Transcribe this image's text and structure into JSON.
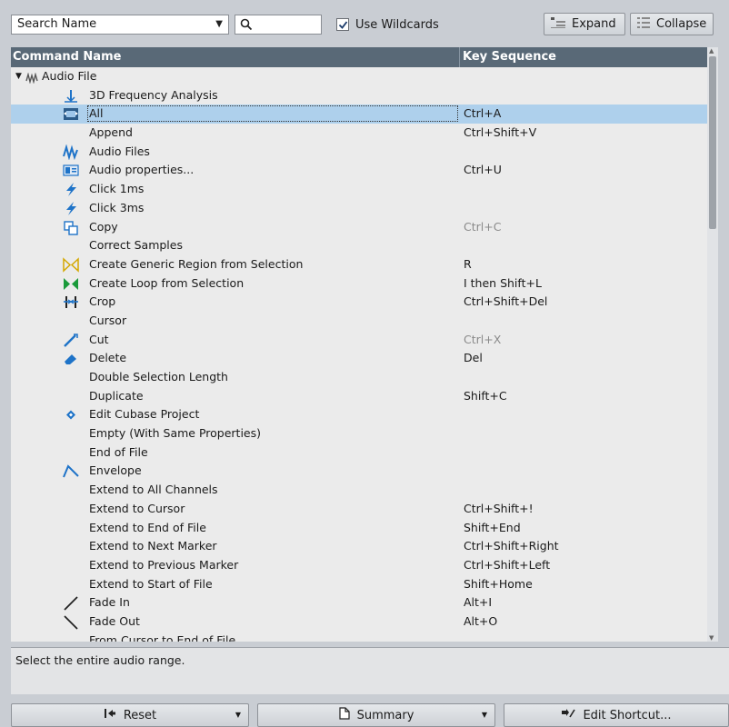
{
  "toolbar": {
    "search_mode": "Search Name",
    "search_value": "",
    "wildcards_label": "Use Wildcards",
    "wildcards_checked": true,
    "expand_label": "Expand",
    "collapse_label": "Collapse"
  },
  "table": {
    "columns": [
      "Command Name",
      "Key Sequence"
    ],
    "root": {
      "label": "Audio File",
      "expanded": true
    },
    "rows": [
      {
        "name": "3D Frequency Analysis",
        "key": "",
        "icon": "3d-analysis-icon"
      },
      {
        "name": "All",
        "key": "Ctrl+A",
        "icon": "select-all-icon",
        "selected": true
      },
      {
        "name": "Append",
        "key": "Ctrl+Shift+V",
        "icon": ""
      },
      {
        "name": "Audio Files",
        "key": "",
        "icon": "waveform-icon"
      },
      {
        "name": "Audio properties...",
        "key": "Ctrl+U",
        "icon": "audio-properties-icon"
      },
      {
        "name": "Click 1ms",
        "key": "",
        "icon": "lightning-icon"
      },
      {
        "name": "Click 3ms",
        "key": "",
        "icon": "lightning-icon"
      },
      {
        "name": "Copy",
        "key": "Ctrl+C",
        "icon": "copy-icon",
        "dim": true
      },
      {
        "name": "Correct Samples",
        "key": "",
        "icon": ""
      },
      {
        "name": "Create Generic Region from Selection",
        "key": "R",
        "icon": "region-icon"
      },
      {
        "name": "Create Loop from Selection",
        "key": "I then Shift+L",
        "icon": "loop-icon"
      },
      {
        "name": "Crop",
        "key": "Ctrl+Shift+Del",
        "icon": "crop-icon"
      },
      {
        "name": "Cursor",
        "key": "",
        "icon": ""
      },
      {
        "name": "Cut",
        "key": "Ctrl+X",
        "icon": "cut-icon",
        "dim": true
      },
      {
        "name": "Delete",
        "key": "Del",
        "icon": "eraser-icon"
      },
      {
        "name": "Double Selection Length",
        "key": "",
        "icon": ""
      },
      {
        "name": "Duplicate",
        "key": "Shift+C",
        "icon": ""
      },
      {
        "name": "Edit Cubase Project",
        "key": "",
        "icon": "cubase-icon"
      },
      {
        "name": "Empty (With Same Properties)",
        "key": "",
        "icon": ""
      },
      {
        "name": "End of File",
        "key": "",
        "icon": ""
      },
      {
        "name": "Envelope",
        "key": "",
        "icon": "envelope-icon"
      },
      {
        "name": "Extend to All Channels",
        "key": "",
        "icon": ""
      },
      {
        "name": "Extend to Cursor",
        "key": "Ctrl+Shift+!",
        "icon": ""
      },
      {
        "name": "Extend to End of File",
        "key": "Shift+End",
        "icon": ""
      },
      {
        "name": "Extend to Next Marker",
        "key": "Ctrl+Shift+Right",
        "icon": ""
      },
      {
        "name": "Extend to Previous Marker",
        "key": "Ctrl+Shift+Left",
        "icon": ""
      },
      {
        "name": "Extend to Start of File",
        "key": "Shift+Home",
        "icon": ""
      },
      {
        "name": "Fade In",
        "key": "Alt+I",
        "icon": "fade-in-icon"
      },
      {
        "name": "Fade Out",
        "key": "Alt+O",
        "icon": "fade-out-icon"
      },
      {
        "name": "From Cursor to End of File",
        "key": "",
        "icon": ""
      }
    ]
  },
  "description": "Select the entire audio range.",
  "buttons": {
    "reset": "Reset",
    "summary": "Summary",
    "edit_shortcut": "Edit Shortcut..."
  },
  "colors": {
    "header_bg": "#596977",
    "selection_bg": "#aed0ec",
    "icon_blue": "#1e73c8"
  }
}
